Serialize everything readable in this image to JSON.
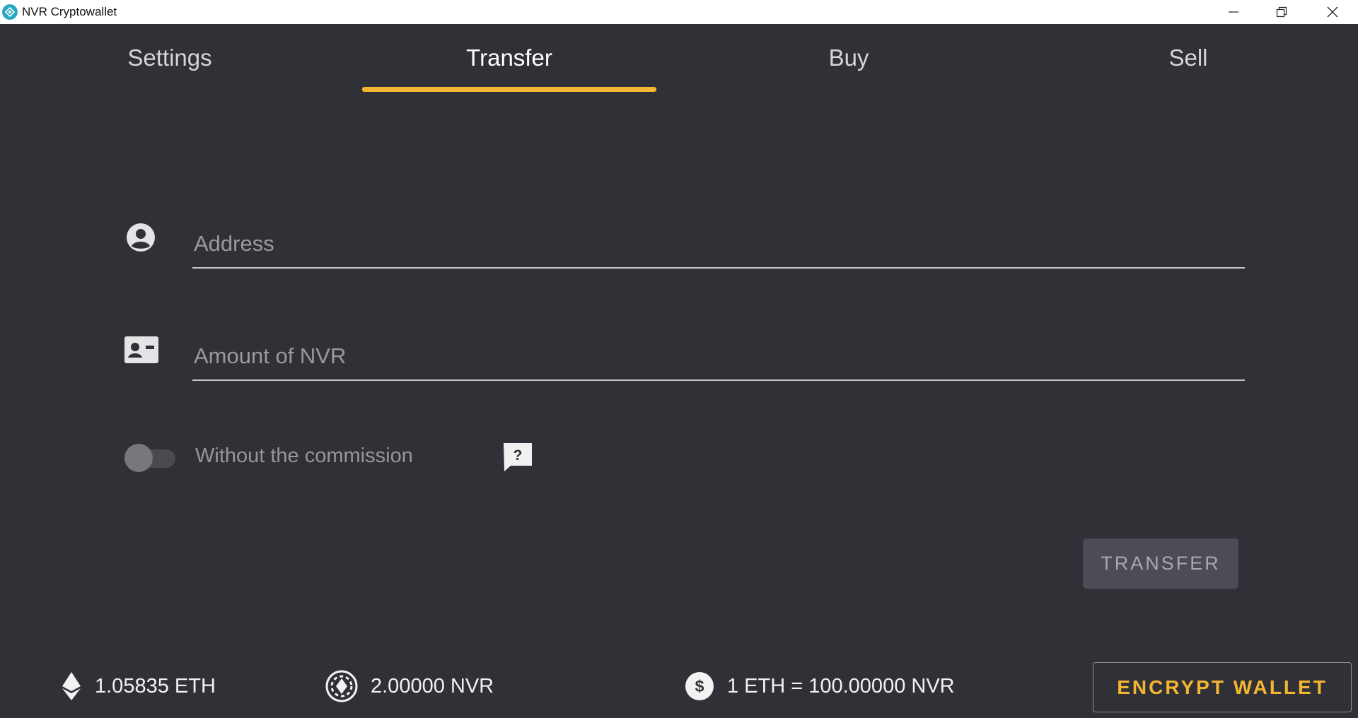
{
  "window": {
    "title": "NVR Cryptowallet"
  },
  "tabs": [
    {
      "label": "Settings",
      "active": false
    },
    {
      "label": "Transfer",
      "active": true
    },
    {
      "label": "Buy",
      "active": false
    },
    {
      "label": "Sell",
      "active": false
    }
  ],
  "form": {
    "address": {
      "placeholder": "Address",
      "value": "",
      "icon": "account-circle-icon"
    },
    "amount": {
      "placeholder": "Amount of NVR",
      "value": "",
      "icon": "contact-card-icon"
    },
    "commission_toggle": {
      "label": "Without the commission",
      "checked": false
    },
    "help_icon": "help-question-icon",
    "transfer_label": "TRANSFER"
  },
  "footer": {
    "eth_balance": "1.05835 ETH",
    "nvr_balance": "2.00000 NVR",
    "rate": "1 ETH = 100.00000 NVR",
    "encrypt_label": "ENCRYPT WALLET"
  },
  "colors": {
    "background": "#303136",
    "accent": "#f4b630",
    "button": "#4b4c55"
  }
}
